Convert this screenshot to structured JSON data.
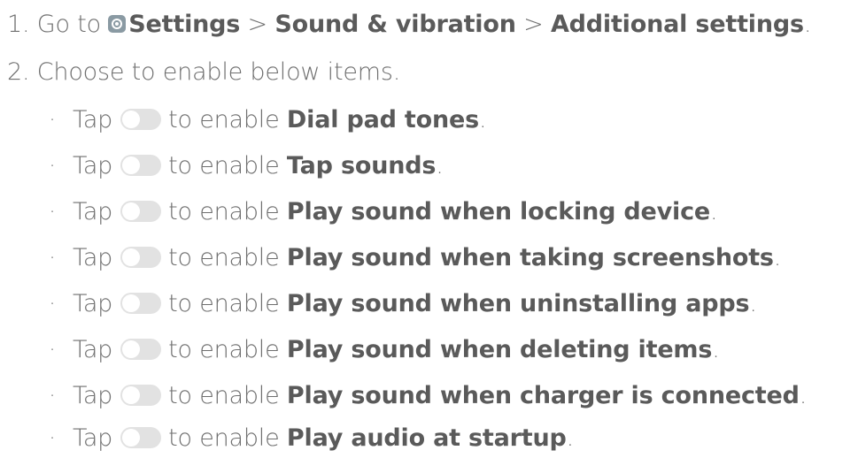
{
  "step1": {
    "number": "1.",
    "prefix": "Go to",
    "path": [
      "Settings",
      "Sound & vibration",
      "Additional settings"
    ],
    "separator": ">",
    "end": "."
  },
  "step2": {
    "number": "2.",
    "text": "Choose to enable below items."
  },
  "items": [
    {
      "bullet": "·",
      "tap": "Tap",
      "mid": "to enable",
      "label": "Dial pad tones",
      "end": "."
    },
    {
      "bullet": "·",
      "tap": "Tap",
      "mid": "to enable",
      "label": "Tap sounds",
      "end": "."
    },
    {
      "bullet": "·",
      "tap": "Tap",
      "mid": "to enable",
      "label": "Play sound when locking device",
      "end": "."
    },
    {
      "bullet": "·",
      "tap": "Tap",
      "mid": "to enable",
      "label": "Play sound when taking screenshots",
      "end": "."
    },
    {
      "bullet": "·",
      "tap": "Tap",
      "mid": "to enable",
      "label": "Play sound when uninstalling apps",
      "end": "."
    },
    {
      "bullet": "·",
      "tap": "Tap",
      "mid": "to enable",
      "label": "Play sound when deleting items",
      "end": "."
    },
    {
      "bullet": "·",
      "tap": "Tap",
      "mid": "to enable",
      "label": "Play sound when charger is connected",
      "end": "."
    },
    {
      "bullet": "·",
      "tap": "Tap",
      "mid": "to enable",
      "label": "Play audio at startup",
      "end": "."
    }
  ],
  "icons": {
    "settings": "settings-icon",
    "toggle": "toggle-switch-icon"
  },
  "colors": {
    "text": "#6f6f6f",
    "bold_text": "#5a5a5a",
    "toggle_off": "#e2e2e2",
    "settings_icon": "#8a9aa3"
  }
}
